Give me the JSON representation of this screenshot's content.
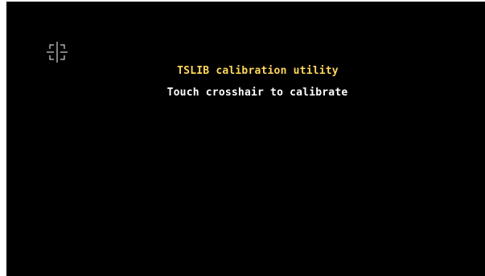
{
  "app": {
    "title": "TSLIB calibration utility",
    "instruction": "Touch crosshair to calibrate"
  },
  "crosshair": {
    "icon": "crosshair-icon",
    "color": "#ffffff"
  },
  "colors": {
    "background": "#000000",
    "title": "#ffd75a",
    "instruction": "#ffffff"
  }
}
